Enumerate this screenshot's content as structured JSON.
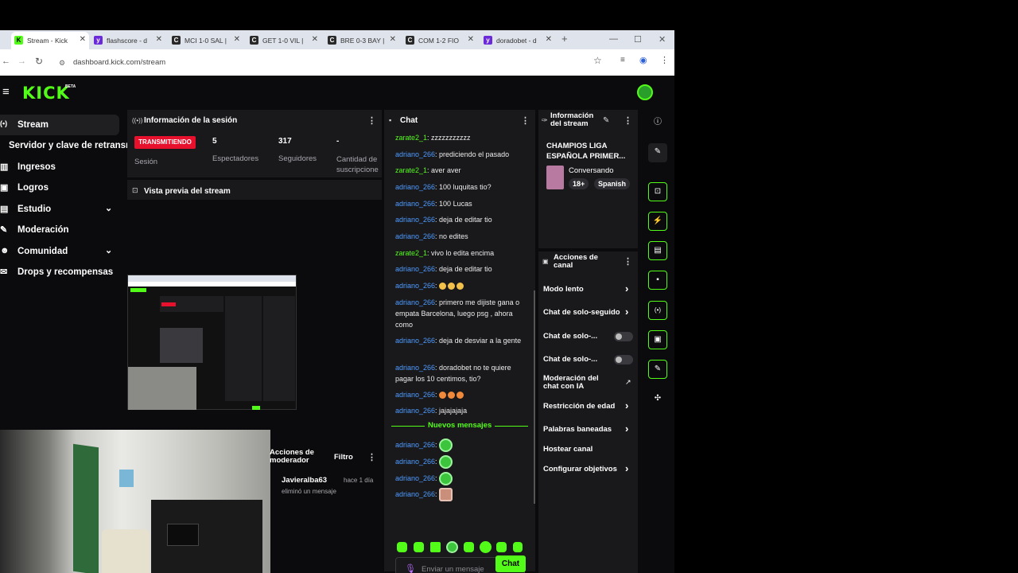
{
  "browser": {
    "tabs": [
      {
        "title": "Stream - Kick",
        "fav": "K",
        "color": "#53fc18"
      },
      {
        "title": "flashscore - d",
        "fav": "y",
        "color": "#6a2ad9"
      },
      {
        "title": "MCI 1-0 SAL |",
        "fav": "C",
        "color": "#2a2a2a"
      },
      {
        "title": "GET 1-0 VIL |",
        "fav": "C",
        "color": "#2a2a2a"
      },
      {
        "title": "BRE 0-3 BAY |",
        "fav": "C",
        "color": "#2a2a2a"
      },
      {
        "title": "COM 1-2 FIO",
        "fav": "C",
        "color": "#2a2a2a"
      },
      {
        "title": "doradobet - d",
        "fav": "y",
        "color": "#6a2ad9"
      }
    ],
    "new_tab": "+",
    "url": "dashboard.kick.com/stream"
  },
  "header": {
    "logo": "KICK",
    "beta": "BETA"
  },
  "sidebar": {
    "items": [
      {
        "label": "Stream",
        "icon": "broadcast-icon"
      },
      {
        "label": "Servidor y clave de retransm",
        "icon": ""
      },
      {
        "label": "Ingresos",
        "icon": "chart-icon"
      },
      {
        "label": "Logros",
        "icon": "trophy-icon"
      },
      {
        "label": "Estudio",
        "icon": "studio-icon"
      },
      {
        "label": "Moderación",
        "icon": "wrench-icon"
      },
      {
        "label": "Comunidad",
        "icon": "people-icon"
      },
      {
        "label": "Drops y recompensas",
        "icon": "gift-icon"
      }
    ]
  },
  "session": {
    "title": "Información de la sesión",
    "status": "TRANSMITIENDO",
    "status_label": "Sesión",
    "viewers": "5",
    "viewers_label": "Espectadores",
    "followers": "317",
    "followers_label": "Seguidores",
    "subs": "-",
    "subs_label": "Cantidad de suscripcione"
  },
  "preview": {
    "title": "Vista previa del stream"
  },
  "modactions": {
    "title": "Acciones de moderador",
    "filter": "Filtro",
    "user": "Javieralba63",
    "time": "hace 1 día",
    "action": "eliminó un mensaje"
  },
  "chat": {
    "title": "Chat",
    "messages": [
      {
        "user": "zarate2_1",
        "color": "g",
        "text": ": zzzzzzzzzzz"
      },
      {
        "user": "adriano_266",
        "color": "b",
        "text": ": prediciendo el pasado"
      },
      {
        "user": "zarate2_1",
        "color": "g",
        "text": ": aver aver"
      },
      {
        "user": "adriano_266",
        "color": "b",
        "text": ": 100 luquitas tio?"
      },
      {
        "user": "adriano_266",
        "color": "b",
        "text": ": 100 Lucas"
      },
      {
        "user": "adriano_266",
        "color": "b",
        "text": ": deja de editar tio"
      },
      {
        "user": "adriano_266",
        "color": "b",
        "text": ": no edites"
      },
      {
        "user": "zarate2_1",
        "color": "g",
        "text": ": vivo lo edita encima"
      },
      {
        "user": "adriano_266",
        "color": "b",
        "text": ": deja de editar tio"
      },
      {
        "user": "adriano_266",
        "color": "b",
        "text": ": "
      },
      {
        "user": "adriano_266",
        "color": "b",
        "text": ": primero me dijiste gana o empata Barcelona, luego psg , ahora como"
      },
      {
        "user": "adriano_266",
        "color": "b",
        "text": ": deja de desviar a la gente"
      },
      {
        "user": "adriano_266",
        "color": "b",
        "text": ": doradobet no te quiere pagar los 10 centimos, tio?"
      },
      {
        "user": "adriano_266",
        "color": "b",
        "text": ": "
      },
      {
        "user": "adriano_266",
        "color": "b",
        "text": ": jajajajaja"
      }
    ],
    "new_messages": "Nuevos mensajes",
    "new": [
      {
        "user": "adriano_266",
        "text": ":"
      },
      {
        "user": "adriano_266",
        "text": ":"
      },
      {
        "user": "adriano_266",
        "text": ":"
      },
      {
        "user": "adriano_266",
        "text": ":"
      }
    ],
    "placeholder": "Enviar un mensaje",
    "send": "Chat"
  },
  "streaminfo": {
    "title": "Información del stream",
    "stream_title": "CHAMPIOS LIGA ESPAÑOLA PRIMER...",
    "category": "Conversando",
    "tag1": "18+",
    "tag2": "Spanish"
  },
  "channel_actions": {
    "title": "Acciones de canal",
    "items": [
      "Modo lento",
      "Chat de solo-seguido",
      "Chat de solo-...",
      "Chat de solo-...",
      "Moderación del chat con IA",
      "Restricción de edad",
      "Palabras baneadas",
      "Hostear canal",
      "Configurar objetivos"
    ]
  }
}
